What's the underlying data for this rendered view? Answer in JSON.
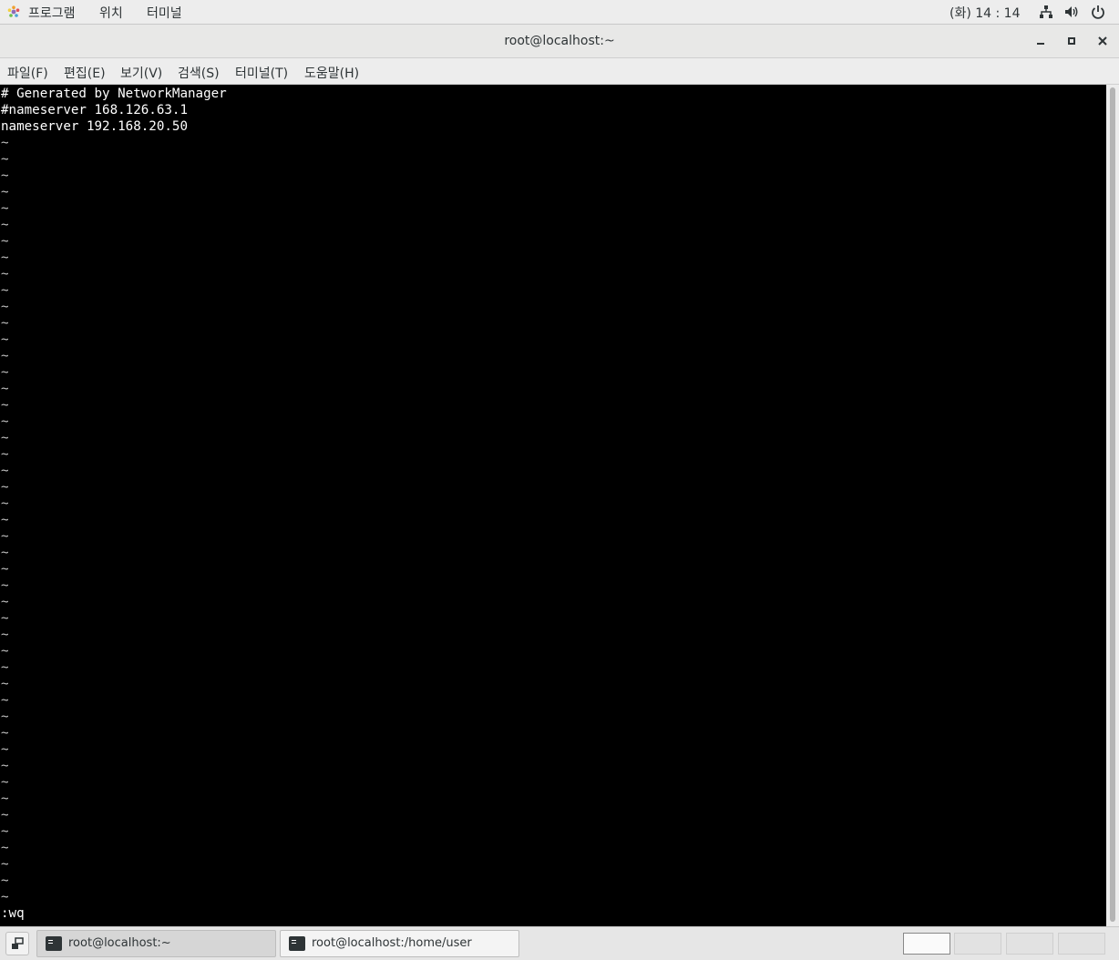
{
  "topbar": {
    "menus": [
      "프로그램",
      "위치",
      "터미널"
    ],
    "clock": "(화) 14 : 14",
    "icons": [
      "network-icon",
      "volume-icon",
      "power-icon"
    ]
  },
  "window": {
    "title": "root@localhost:~",
    "buttons": [
      "minimize",
      "maximize",
      "close"
    ]
  },
  "menubar": {
    "items": [
      "파일(F)",
      "편집(E)",
      "보기(V)",
      "검색(S)",
      "터미널(T)",
      "도움말(H)"
    ]
  },
  "terminal": {
    "lines": [
      "# Generated by NetworkManager",
      "#nameserver 168.126.63.1",
      "nameserver 192.168.20.50"
    ],
    "empty_line_marker": "~",
    "command_line": ":wq"
  },
  "taskbar": {
    "tasks": [
      {
        "label": "root@localhost:~",
        "active": true
      },
      {
        "label": "root@localhost:/home/user",
        "active": false
      }
    ],
    "workspaces": 4
  },
  "colors": {
    "terminal_bg": "#000000",
    "terminal_fg": "#ffffff",
    "chrome_bg": "#ededed"
  }
}
